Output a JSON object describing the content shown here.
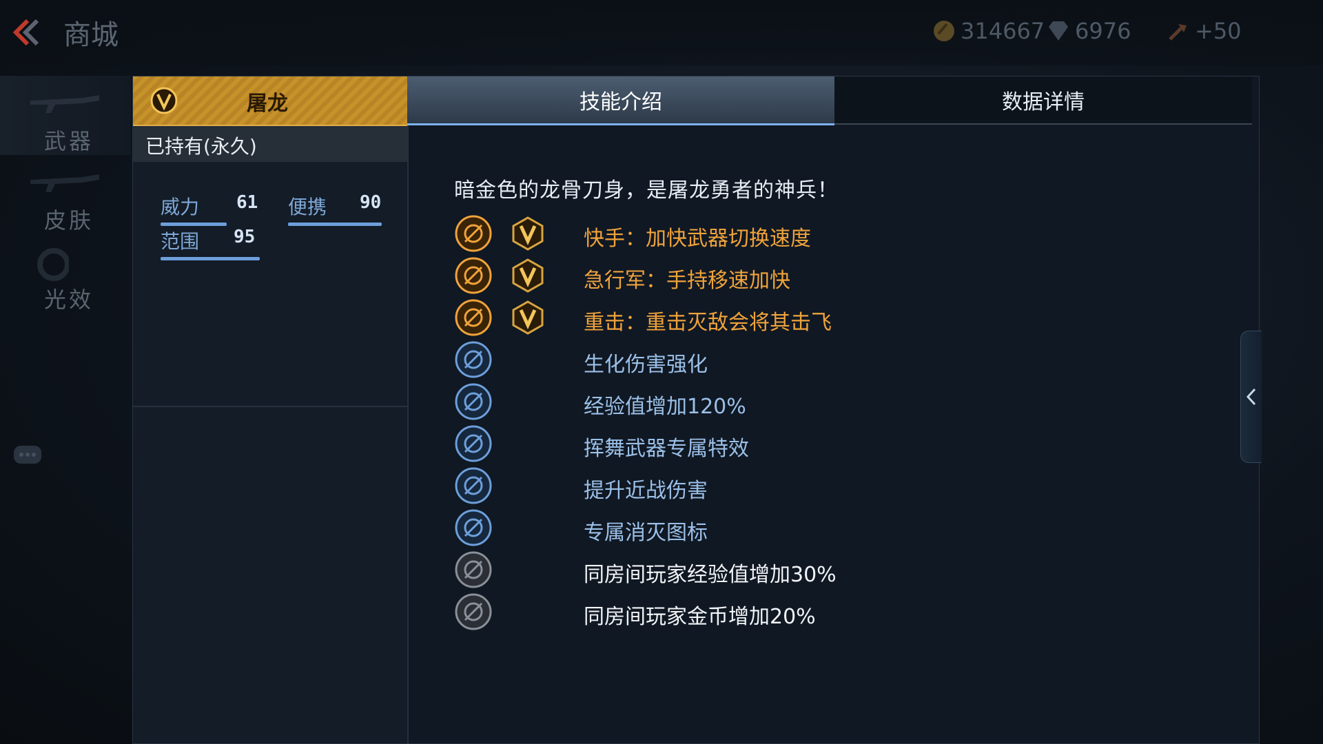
{
  "header": {
    "title": "商城",
    "currencies": [
      {
        "icon": "gold-coin-icon",
        "value": "314667"
      },
      {
        "icon": "diamond-icon",
        "value": "6976"
      },
      {
        "icon": "hammer-icon",
        "value": "+50"
      }
    ]
  },
  "nav": {
    "items": [
      {
        "label": "武器",
        "icon": "rifle-icon",
        "active": true
      },
      {
        "label": "皮肤",
        "icon": "skin-rifle-icon",
        "active": false
      },
      {
        "label": "光效",
        "icon": "glow-effect-icon",
        "active": false
      }
    ]
  },
  "item": {
    "name": "屠龙",
    "ownership": "已持有(永久)",
    "stats": [
      {
        "label": "威力",
        "value": "61"
      },
      {
        "label": "便携",
        "value": "90"
      },
      {
        "label": "范围",
        "value": "95"
      }
    ]
  },
  "tabs": [
    {
      "label": "技能介绍",
      "active": true
    },
    {
      "label": "数据详情",
      "active": false
    }
  ],
  "description": "暗金色的龙骨刀身，是屠龙勇者的神兵！",
  "skills": [
    {
      "text": "快手：加快武器切换速度",
      "tier": "gold",
      "icon": "quick-switch-icon",
      "vip": true
    },
    {
      "text": "急行军：手持移速加快",
      "tier": "gold",
      "icon": "running-man-icon",
      "vip": true
    },
    {
      "text": "重击：重击灭敌会将其击飞",
      "tier": "gold",
      "icon": "heavy-strike-icon",
      "vip": true
    },
    {
      "text": "生化伤害强化",
      "tier": "blue",
      "icon": "biohazard-damage-icon",
      "vip": false
    },
    {
      "text": "经验值增加120%",
      "tier": "blue",
      "icon": "exp-boost-icon",
      "vip": false
    },
    {
      "text": "挥舞武器专属特效",
      "tier": "blue",
      "icon": "swing-effect-icon",
      "vip": false
    },
    {
      "text": "提升近战伤害",
      "tier": "blue",
      "icon": "melee-damage-icon",
      "vip": false
    },
    {
      "text": "专属消灭图标",
      "tier": "blue",
      "icon": "kill-icon-badge-icon",
      "vip": false
    },
    {
      "text": "同房间玩家经验值增加30%",
      "tier": "white",
      "icon": "room-exp-icon",
      "vip": false
    },
    {
      "text": "同房间玩家金币增加20%",
      "tier": "white",
      "icon": "room-gold-icon",
      "vip": false
    }
  ],
  "colors": {
    "gold": "#f0a33b",
    "blue": "#9bc0e8",
    "accent": "#7db2ee"
  }
}
